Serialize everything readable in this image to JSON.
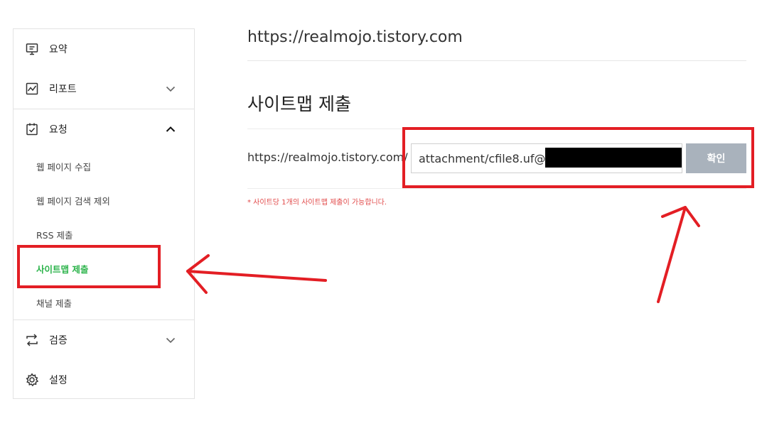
{
  "sidebar": {
    "items": [
      {
        "label": "요약",
        "icon": "summary-icon"
      },
      {
        "label": "리포트",
        "icon": "report-icon"
      },
      {
        "label": "요청",
        "icon": "request-icon"
      },
      {
        "label": "검증",
        "icon": "verify-icon"
      },
      {
        "label": "설정",
        "icon": "gear-icon"
      }
    ],
    "request_sub": [
      {
        "label": "웹 페이지 수집"
      },
      {
        "label": "웹 페이지 검색 제외"
      },
      {
        "label": "RSS 제출"
      },
      {
        "label": "사이트맵 제출",
        "active": true
      },
      {
        "label": "채널 제출"
      }
    ]
  },
  "main": {
    "site_url": "https://realmojo.tistory.com",
    "title": "사이트맵 제출",
    "url_prefix": "https://realmojo.tistory.com/",
    "input_value": "attachment/cfile8.uf@",
    "confirm_label": "확인",
    "notice": "* 사이트당 1개의 사이트맵 제출이 가능합니다."
  },
  "colors": {
    "active_green": "#2bb34a",
    "annotation_red": "#e31e24",
    "button_gray": "#a9b2bc",
    "notice_red": "#e24a4a"
  }
}
